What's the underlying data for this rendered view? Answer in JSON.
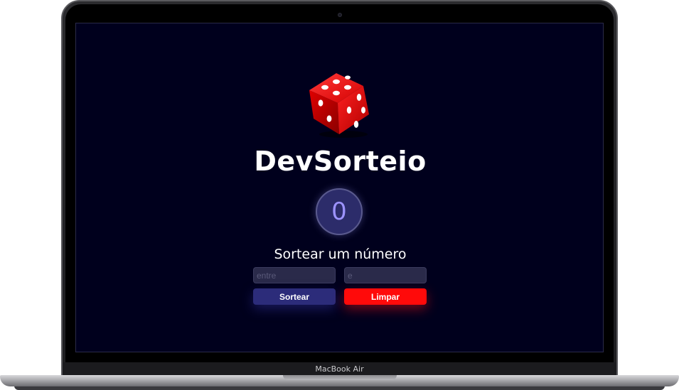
{
  "device": {
    "model_label": "MacBook Air"
  },
  "app": {
    "title": "DevSorteio",
    "result_value": "0",
    "subtitle": "Sortear um número",
    "inputs": {
      "min_placeholder": "entre",
      "max_placeholder": "e"
    },
    "buttons": {
      "draw_label": "Sortear",
      "clear_label": "Limpar"
    }
  },
  "colors": {
    "screen_background": "#00001d",
    "draw_button": "#2c2c7a",
    "clear_button": "#ff0a0a",
    "result_text": "#9d93ff",
    "dice": "#e50914"
  },
  "icons": {
    "logo": "red-dice-icon"
  }
}
